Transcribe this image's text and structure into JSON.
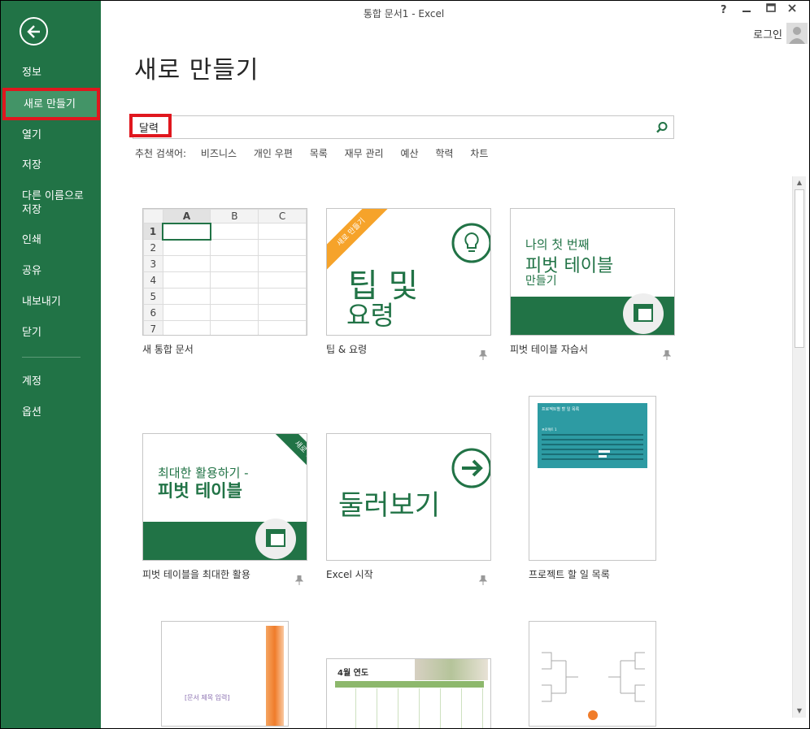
{
  "window": {
    "title": "통합 문서1 - Excel",
    "help": "?",
    "account": "로그인"
  },
  "sidebar": {
    "items": [
      {
        "label": "정보"
      },
      {
        "label": "새로 만들기"
      },
      {
        "label": "열기"
      },
      {
        "label": "저장"
      },
      {
        "label": "다른 이름으로 저장"
      },
      {
        "label": "인쇄"
      },
      {
        "label": "공유"
      },
      {
        "label": "내보내기"
      },
      {
        "label": "닫기"
      },
      {
        "label": "계정"
      },
      {
        "label": "옵션"
      }
    ]
  },
  "main": {
    "title": "새로 만들기",
    "search": {
      "value": "달력"
    },
    "suggested_label": "추천 검색어:",
    "suggested": [
      "비즈니스",
      "개인 우편",
      "목록",
      "재무 관리",
      "예산",
      "학력",
      "차트"
    ]
  },
  "templates": [
    {
      "label": "새 통합 문서",
      "cols": [
        "A",
        "B",
        "C"
      ],
      "rows": [
        "1",
        "2",
        "3",
        "4",
        "5",
        "6",
        "7"
      ]
    },
    {
      "label": "팁 & 요령",
      "ribbon": "새로 만들기",
      "big1": "팁 및",
      "big2": "요령"
    },
    {
      "label": "피벗 테이블 자습서",
      "l1": "나의 첫 번째",
      "l2": "피벗 테이블",
      "l3": "만들기"
    },
    {
      "label": "피벗 테이블을 최대한 활용",
      "ribbon": "새로 만들기",
      "l1": "최대한 활용하기 -",
      "l2": "피벗 테이블"
    },
    {
      "label": "Excel 시작",
      "big": "둘러보기"
    },
    {
      "label": "프로젝트 할 일 목록",
      "header": "프로젝트별 할 일 목록",
      "sub": "프로젝트 1"
    },
    {
      "doc_title": "[문서 제목 입력]"
    },
    {
      "cal_title": "4월 연도"
    },
    {}
  ],
  "colors": {
    "accent": "#217346",
    "highlight": "#e0171e"
  }
}
